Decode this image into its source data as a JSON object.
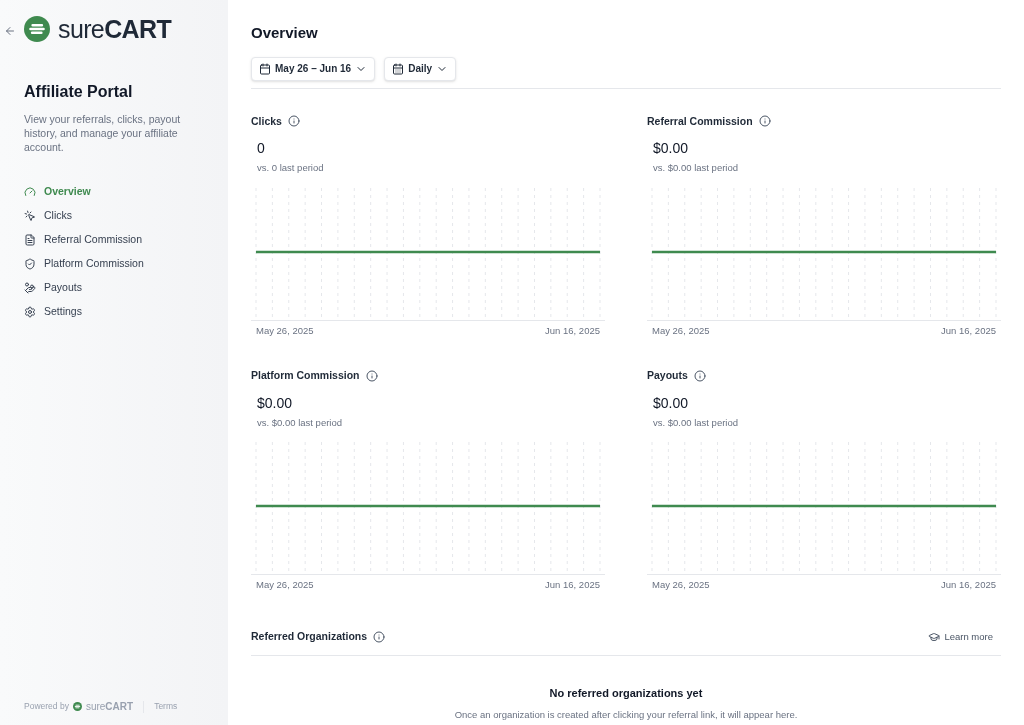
{
  "sidebar": {
    "logo": {
      "light": "sure",
      "bold": "CART"
    },
    "title": "Affiliate Portal",
    "description": "View your referrals, clicks, payout history, and manage your affiliate account.",
    "items": [
      {
        "label": "Overview",
        "selected": true
      },
      {
        "label": "Clicks",
        "selected": false
      },
      {
        "label": "Referral Commission",
        "selected": false
      },
      {
        "label": "Platform Commission",
        "selected": false
      },
      {
        "label": "Payouts",
        "selected": false
      },
      {
        "label": "Settings",
        "selected": false
      }
    ],
    "footer": {
      "powered_by": "Powered by",
      "logo": {
        "light": "sure",
        "bold": "CART"
      },
      "terms": "Terms"
    }
  },
  "main": {
    "title": "Overview",
    "filters": [
      {
        "kind": "date",
        "label": "May 26 – Jun 16"
      },
      {
        "kind": "interval",
        "label": "Daily"
      }
    ],
    "cards": [
      {
        "title": "Clicks",
        "value": "0",
        "comparison": "vs. 0 last period",
        "start": "May 26, 2025",
        "end": "Jun 16, 2025"
      },
      {
        "title": "Referral Commission",
        "value": "$0.00",
        "comparison": "vs. $0.00 last period",
        "start": "May 26, 2025",
        "end": "Jun 16, 2025"
      },
      {
        "title": "Platform Commission",
        "value": "$0.00",
        "comparison": "vs. $0.00 last period",
        "start": "May 26, 2025",
        "end": "Jun 16, 2025"
      },
      {
        "title": "Payouts",
        "value": "$0.00",
        "comparison": "vs. $0.00 last period",
        "start": "May 26, 2025",
        "end": "Jun 16, 2025"
      }
    ],
    "referred": {
      "title": "Referred Organizations",
      "learn_more": "Learn more",
      "empty_title": "No referred organizations yet",
      "empty_text": "Once an organization is created after clicking your referral link, it will appear here."
    }
  }
}
